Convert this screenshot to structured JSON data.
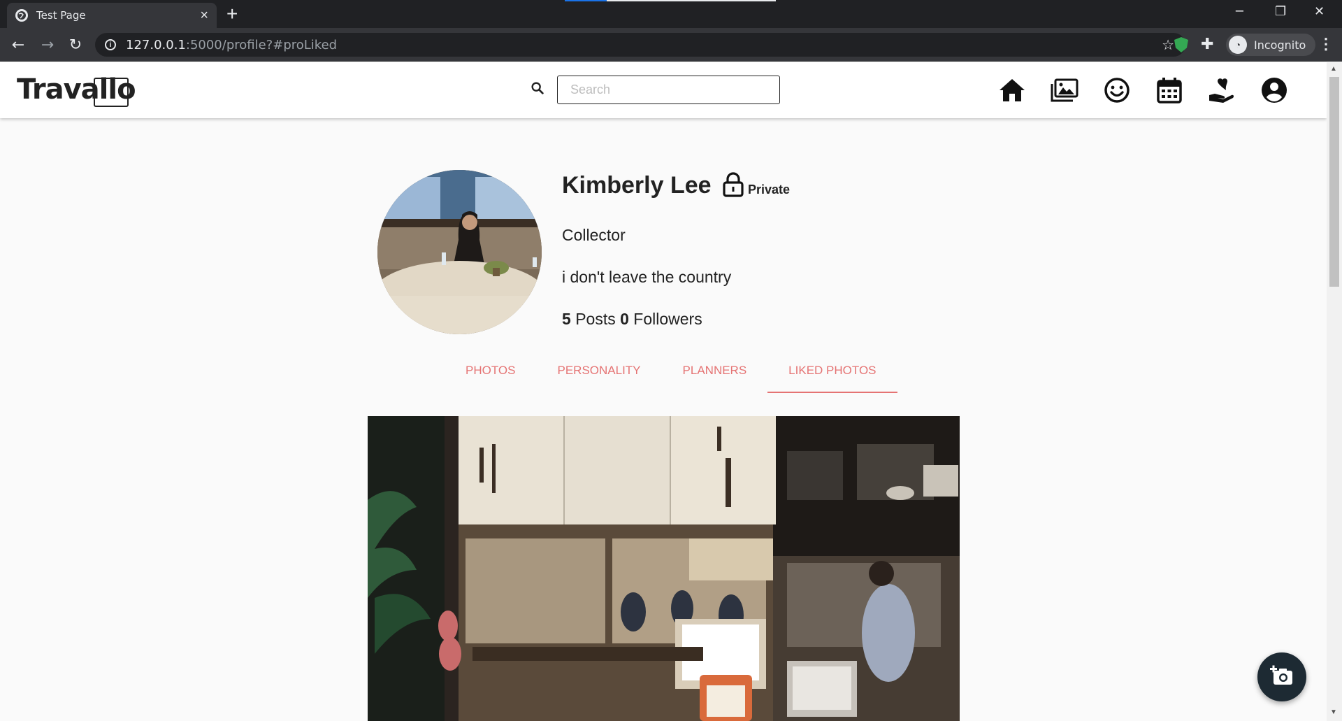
{
  "browser": {
    "tab_title": "Test Page",
    "tab_close": "×",
    "new_tab": "+",
    "url_host": "127.0.0.1",
    "url_rest": ":5000/profile?#proLiked",
    "profile_label": "Incognito"
  },
  "app": {
    "logo": "Travallo",
    "search_placeholder": "Search",
    "nav_icons": [
      "home-icon",
      "gallery-icon",
      "smile-icon",
      "calendar-icon",
      "heart-hand-icon",
      "account-icon"
    ]
  },
  "profile": {
    "name": "Kimberly Lee",
    "privacy": "Private",
    "role": "Collector",
    "bio": "i don't leave the country",
    "posts_count": "5",
    "posts_label": "Posts",
    "followers_count": "0",
    "followers_label": "Followers"
  },
  "tabs": [
    {
      "label": "PHOTOS",
      "active": false
    },
    {
      "label": "PERSONALITY",
      "active": false
    },
    {
      "label": "PLANNERS",
      "active": false
    },
    {
      "label": "LIKED PHOTOS",
      "active": true
    }
  ],
  "colors": {
    "accent": "#e57373",
    "header_bg": "#ffffff",
    "page_bg": "#fafafa",
    "fab_bg": "#1d2a33",
    "chrome_dark": "#202124"
  }
}
